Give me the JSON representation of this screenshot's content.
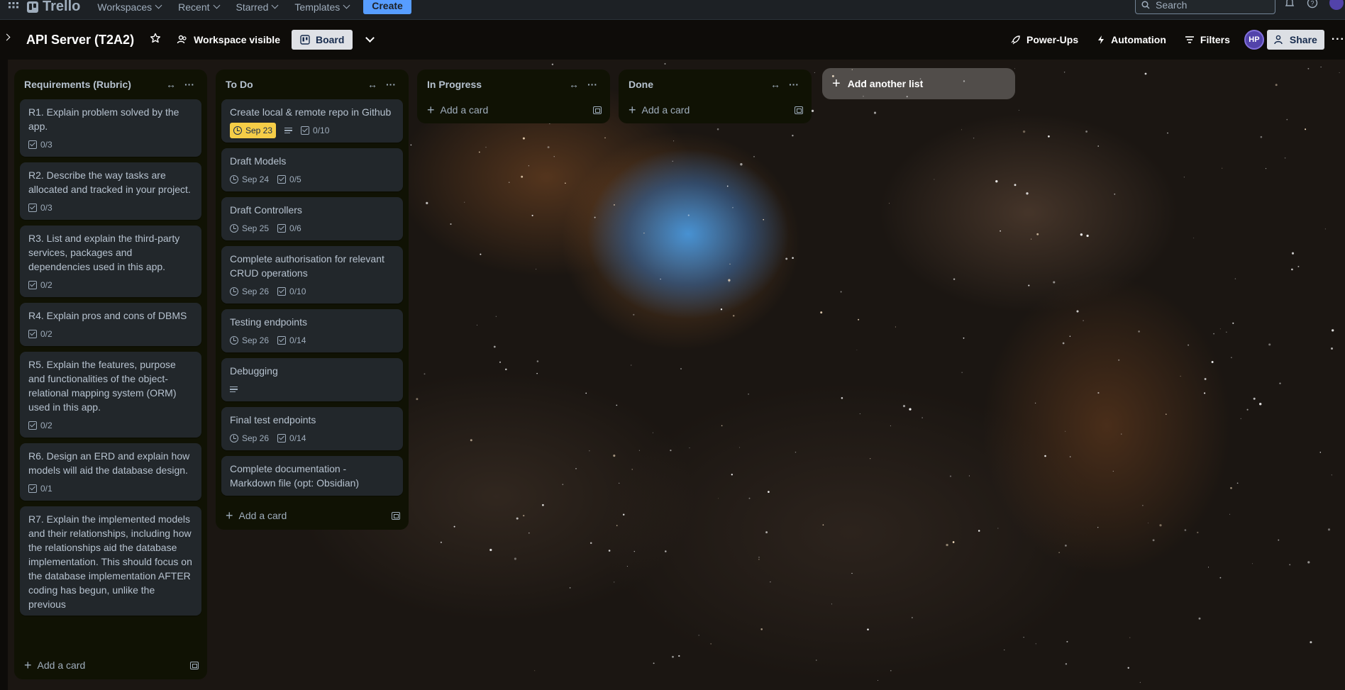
{
  "colors": {
    "accent": "#579dff",
    "list_bg": "#101204",
    "card_bg": "#22272b",
    "due_soon": "#f5cd47",
    "avatar": "#5243aa"
  },
  "topbar": {
    "logo": "Trello",
    "nav": [
      "Workspaces",
      "Recent",
      "Starred",
      "Templates"
    ],
    "create_label": "Create",
    "search_placeholder": "Search",
    "icons": [
      "apps-icon",
      "notifications-icon",
      "help-icon",
      "account-avatar-icon"
    ]
  },
  "board": {
    "title": "API Server (T2A2)",
    "visibility_label": "Workspace visible",
    "view_label": "Board",
    "powerups_label": "Power-Ups",
    "automation_label": "Automation",
    "filters_label": "Filters",
    "member_initials": "HP",
    "share_label": "Share"
  },
  "lists": [
    {
      "title": "Requirements (Rubric)",
      "footer": "Add a card",
      "cards": [
        {
          "title": "R1. Explain problem solved by the app.",
          "checklist": "0/3"
        },
        {
          "title": "R2. Describe the way tasks are allocated and tracked in your project.",
          "checklist": "0/3"
        },
        {
          "title": "R3. List and explain the third-party services, packages and dependencies used in this app.",
          "checklist": "0/2"
        },
        {
          "title": "R4. Explain pros and cons of DBMS",
          "checklist": "0/2"
        },
        {
          "title": "R5. Explain the features, purpose and functionalities of the object-relational mapping system (ORM) used in this app.",
          "checklist": "0/2"
        },
        {
          "title": "R6. Design an ERD and explain how models will aid the database design.",
          "checklist": "0/1"
        },
        {
          "title": "R7. Explain the implemented models and their relationships, including how the relationships aid the database implementation. This should focus on the database implementation AFTER coding has begun, unlike the previous",
          "checklist": ""
        }
      ]
    },
    {
      "title": "To Do",
      "footer": "Add a card",
      "cards": [
        {
          "title": "Create local & remote repo in Github",
          "due": "Sep 23",
          "due_soon": true,
          "description": true,
          "checklist": "0/10"
        },
        {
          "title": "Draft Models",
          "due": "Sep 24",
          "checklist": "0/5"
        },
        {
          "title": "Draft Controllers",
          "due": "Sep 25",
          "checklist": "0/6"
        },
        {
          "title": "Complete authorisation for relevant CRUD operations",
          "due": "Sep 26",
          "checklist": "0/10"
        },
        {
          "title": "Testing endpoints",
          "due": "Sep 26",
          "checklist": "0/14"
        },
        {
          "title": "Debugging",
          "description": true
        },
        {
          "title": "Final test endpoints",
          "due": "Sep 26",
          "checklist": "0/14"
        },
        {
          "title": "Complete documentation - Markdown file (opt: Obsidian)"
        }
      ]
    },
    {
      "title": "In Progress",
      "footer": "Add a card",
      "cards": []
    },
    {
      "title": "Done",
      "footer": "Add a card",
      "cards": []
    }
  ],
  "add_list_label": "Add another list"
}
